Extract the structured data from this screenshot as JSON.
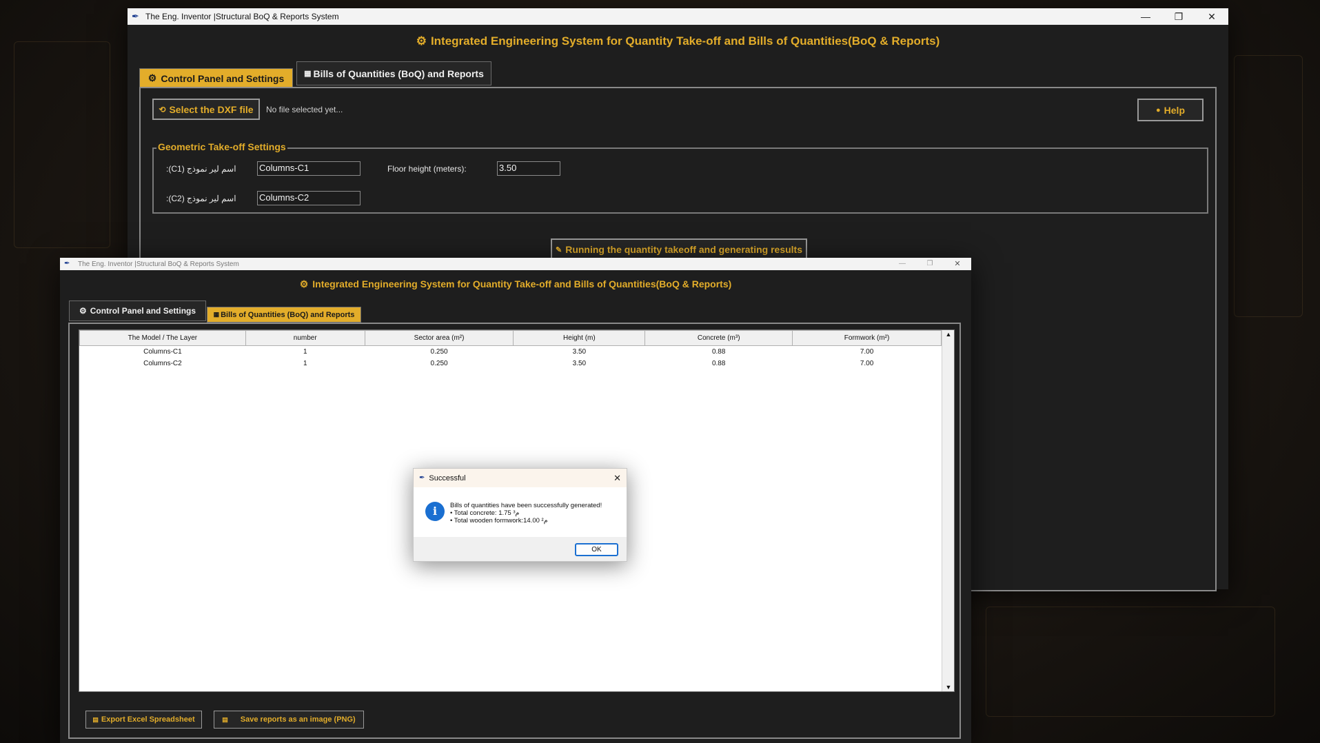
{
  "colors": {
    "accent": "#e3ad2a",
    "panel": "#1e1e1e",
    "dialog_button": "#1a6fd1"
  },
  "back_window": {
    "title": "The Eng. Inventor |Structural BoQ & Reports System",
    "app_title": "Integrated Engineering System for Quantity Take-off and Bills of Quantities(BoQ & Reports)",
    "tabs": [
      {
        "label": "Control Panel and Settings",
        "active": true,
        "icon": "gear-icon"
      },
      {
        "label": "Bills of Quantities (BoQ) and Reports",
        "active": false,
        "icon": "calculator-icon"
      }
    ],
    "select_button": "Select the DXF file",
    "file_status": "No file selected yet...",
    "help_button": "Help",
    "settings_group": "Geometric Take-off Settings",
    "fields": {
      "c1_label": "اسم لير نموذج (C1):",
      "c1_value": "Columns-C1",
      "c2_label": "اسم لير نموذج (C2):",
      "c2_value": "Columns-C2",
      "floor_label": "Floor height (meters):",
      "floor_value": "3.50"
    },
    "run_button": "Running the quantity takeoff and generating results"
  },
  "front_window": {
    "title": "The Eng. Inventor |Structural BoQ & Reports System",
    "app_title": "Integrated Engineering System for Quantity Take-off and Bills of Quantities(BoQ & Reports)",
    "tabs": [
      {
        "label": "Control Panel and Settings",
        "active": false,
        "icon": "gear-icon"
      },
      {
        "label": "Bills of Quantities (BoQ) and Reports",
        "active": true,
        "icon": "calculator-icon"
      }
    ],
    "table": {
      "headers": [
        "The Model / The Layer",
        "number",
        "Sector area (m²)",
        "Height (m)",
        "Concrete (m³)",
        "Formwork (m²)"
      ],
      "rows": [
        [
          "Columns-C1",
          "1",
          "0.250",
          "3.50",
          "0.88",
          "7.00"
        ],
        [
          "Columns-C2",
          "1",
          "0.250",
          "3.50",
          "0.88",
          "7.00"
        ]
      ]
    },
    "export_excel_button": "Export Excel Spreadsheet",
    "save_png_button": "Save reports as an image (PNG)"
  },
  "dialog": {
    "title": "Successful",
    "line1": "Bills of quantities have been successfully generated!",
    "line2": "• Total concrete: 1.75 م³",
    "line3": "• Total wooden formwork:14.00 م²",
    "ok_button": "OK"
  }
}
